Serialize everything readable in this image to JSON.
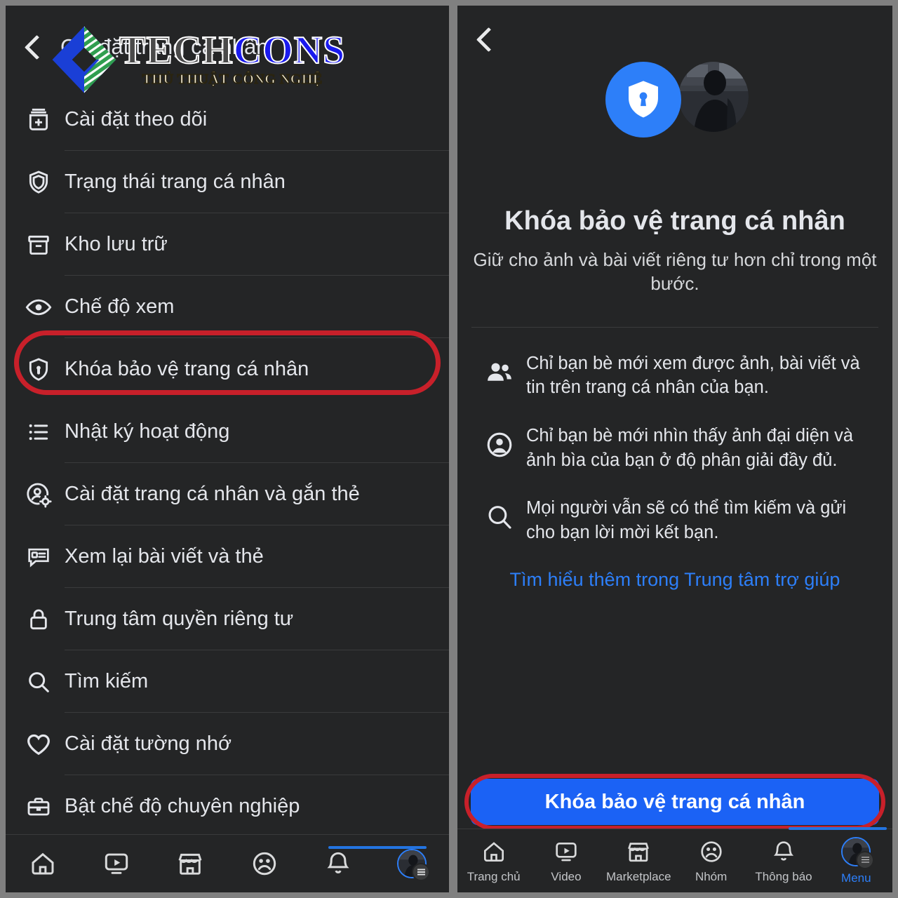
{
  "watermark": {
    "main_part1": "TECH",
    "main_part2": "CONS",
    "subtitle": "THỦ THUẬT CÔNG NGHỆ",
    "logo_icon": "techcons-cube-logo"
  },
  "left_panel": {
    "back_icon": "back-chevron-icon",
    "title": "Cài đặt trang cá nhân",
    "menu_items": [
      {
        "icon": "add-to-favorites-icon",
        "label": "Cài đặt theo dõi"
      },
      {
        "icon": "shield-icon",
        "label": "Trạng thái trang cá nhân"
      },
      {
        "icon": "archive-box-icon",
        "label": "Kho lưu trữ"
      },
      {
        "icon": "eye-icon",
        "label": "Chế độ xem"
      },
      {
        "icon": "shield-lock-icon",
        "label": "Khóa bảo vệ trang cá nhân",
        "highlighted": true
      },
      {
        "icon": "activity-list-icon",
        "label": "Nhật ký hoạt động"
      },
      {
        "icon": "profile-gear-icon",
        "label": "Cài đặt trang cá nhân và gắn thẻ"
      },
      {
        "icon": "review-post-icon",
        "label": "Xem lại bài viết và thẻ"
      },
      {
        "icon": "padlock-icon",
        "label": "Trung tâm quyền riêng tư"
      },
      {
        "icon": "search-icon",
        "label": "Tìm kiếm"
      },
      {
        "icon": "heart-icon",
        "label": "Cài đặt tường nhớ"
      },
      {
        "icon": "briefcase-icon",
        "label": "Bật chế độ chuyên nghiệp"
      }
    ],
    "bottom_nav": [
      {
        "icon": "home-icon"
      },
      {
        "icon": "video-icon"
      },
      {
        "icon": "marketplace-icon"
      },
      {
        "icon": "groups-icon"
      },
      {
        "icon": "bell-icon"
      },
      {
        "icon": "menu-avatar-icon",
        "active": true
      }
    ]
  },
  "right_panel": {
    "back_icon": "back-chevron-icon",
    "hero": {
      "badge_icon": "shield-keyhole-icon",
      "avatar_icon": "profile-photo-avatar"
    },
    "title": "Khóa bảo vệ trang cá nhân",
    "subtitle": "Giữ cho ảnh và bài viết riêng tư hơn chỉ trong một bước.",
    "features": [
      {
        "icon": "friends-icon",
        "text": "Chỉ bạn bè mới xem được ảnh, bài viết và tin trên trang cá nhân của bạn."
      },
      {
        "icon": "person-circle-icon",
        "text": "Chỉ bạn bè mới nhìn thấy ảnh đại diện và ảnh bìa của bạn ở độ phân giải đầy đủ."
      },
      {
        "icon": "search-icon",
        "text": "Mọi người vẫn sẽ có thể tìm kiếm và gửi cho bạn lời mời kết bạn."
      }
    ],
    "learn_more": "Tìm hiểu thêm trong Trung tâm trợ giúp",
    "cta_label": "Khóa bảo vệ trang cá nhân",
    "bottom_nav": [
      {
        "icon": "home-icon",
        "label": "Trang chủ"
      },
      {
        "icon": "video-icon",
        "label": "Video"
      },
      {
        "icon": "marketplace-icon",
        "label": "Marketplace"
      },
      {
        "icon": "groups-icon",
        "label": "Nhóm"
      },
      {
        "icon": "bell-icon",
        "label": "Thông báo"
      },
      {
        "icon": "menu-avatar-icon",
        "label": "Menu",
        "active": true
      }
    ]
  },
  "colors": {
    "background": "#242526",
    "frame": "#808080",
    "divider": "#3a3b3c",
    "text_primary": "#e4e6eb",
    "accent_blue": "#2d7ff9",
    "cta_blue": "#1b62f5",
    "annotation_red": "#c8202a"
  }
}
